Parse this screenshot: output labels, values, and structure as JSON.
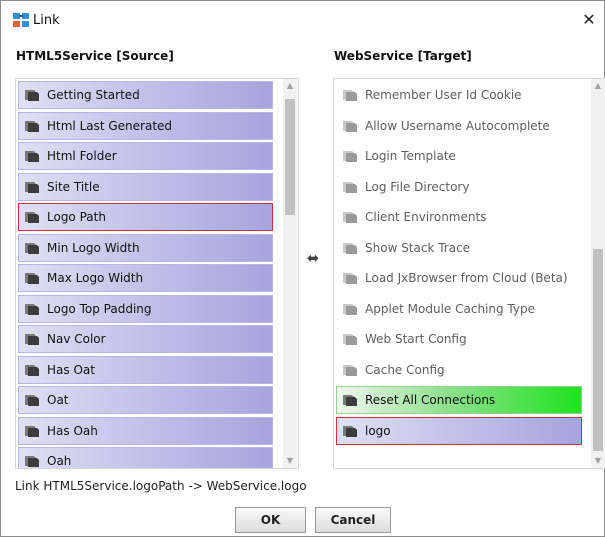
{
  "window": {
    "title": "Link",
    "close_glyph": "✕"
  },
  "source": {
    "header": "HTML5Service [Source]",
    "items": [
      {
        "label": "Getting Started",
        "icon": "slot-icon",
        "selected": false
      },
      {
        "label": "Html Last Generated",
        "icon": "slot-icon",
        "selected": false
      },
      {
        "label": "Html Folder",
        "icon": "slot-icon",
        "selected": false
      },
      {
        "label": "Site Title",
        "icon": "slot-icon",
        "selected": false
      },
      {
        "label": "Logo Path",
        "icon": "slot-icon",
        "selected": true
      },
      {
        "label": "Min Logo Width",
        "icon": "slot-icon",
        "selected": false
      },
      {
        "label": "Max Logo Width",
        "icon": "slot-icon",
        "selected": false
      },
      {
        "label": "Logo Top Padding",
        "icon": "slot-icon",
        "selected": false
      },
      {
        "label": "Nav Color",
        "icon": "slot-icon",
        "selected": false
      },
      {
        "label": "Has Oat",
        "icon": "slot-icon",
        "selected": false
      },
      {
        "label": "Oat",
        "icon": "slot-icon",
        "selected": false
      },
      {
        "label": "Has Oah",
        "icon": "slot-icon",
        "selected": false
      },
      {
        "label": "Oah",
        "icon": "slot-icon",
        "selected": false
      }
    ]
  },
  "target": {
    "header": "WebService [Target]",
    "items": [
      {
        "label": "Remember User Id Cookie",
        "icon": "slot-icon",
        "state": "disabled"
      },
      {
        "label": "Allow Username Autocomplete",
        "icon": "slot-icon",
        "state": "disabled"
      },
      {
        "label": "Login Template",
        "icon": "slot-icon",
        "state": "disabled"
      },
      {
        "label": "Log File Directory",
        "icon": "slot-icon",
        "state": "disabled"
      },
      {
        "label": "Client Environments",
        "icon": "slot-icon",
        "state": "disabled"
      },
      {
        "label": "Show Stack Trace",
        "icon": "slot-icon",
        "state": "disabled"
      },
      {
        "label": "Load JxBrowser from Cloud (Beta)",
        "icon": "slot-icon",
        "state": "disabled"
      },
      {
        "label": "Applet Module Caching Type",
        "icon": "slot-icon",
        "state": "disabled"
      },
      {
        "label": "Web Start Config",
        "icon": "slot-icon",
        "state": "disabled"
      },
      {
        "label": "Cache Config",
        "icon": "slot-icon",
        "state": "disabled"
      },
      {
        "label": "Reset All Connections",
        "icon": "slot-icon",
        "state": "action"
      },
      {
        "label": "logo",
        "icon": "slot-icon",
        "state": "selected"
      }
    ]
  },
  "link_arrow_glyph": "⬌",
  "status_text": "Link HTML5Service.logoPath -> WebService.logo",
  "buttons": {
    "ok": "OK",
    "cancel": "Cancel"
  },
  "colors": {
    "item_gradient_start": "#e0dff4",
    "item_gradient_end": "#a7a4de",
    "selection_border": "#c8343c",
    "action_gradient_end": "#1ee21f",
    "disabled_text": "#5e5e5e"
  }
}
